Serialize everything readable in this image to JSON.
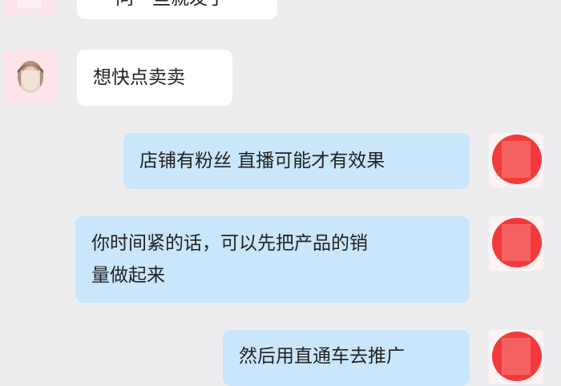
{
  "messages": [
    {
      "side": "in",
      "text": "问一些就发了"
    },
    {
      "side": "in",
      "text": "想快点卖卖"
    },
    {
      "side": "out",
      "text": "店铺有粉丝 直播可能才有效果"
    },
    {
      "side": "out",
      "lines": [
        "你时间紧的话，可以先把产品的销",
        "量做起来"
      ]
    },
    {
      "side": "out",
      "text": "然后用直通车去推广"
    }
  ],
  "colors": {
    "background": "#ededf0",
    "incoming_bubble": "#ffffff",
    "outgoing_bubble": "#c9e6fb",
    "avatar_red": "#f33a3a"
  }
}
